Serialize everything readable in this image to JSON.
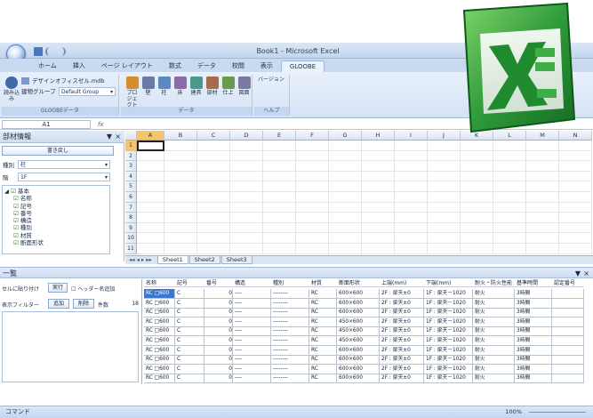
{
  "window_title": "Book1 - Microsoft Excel",
  "tabs": [
    "ホーム",
    "挿入",
    "ページ レイアウト",
    "数式",
    "データ",
    "校閲",
    "表示",
    "GLOOBE"
  ],
  "ribbon": {
    "file_label": "デザインオフィスゼル.mdb",
    "group_label": "建物グループ",
    "group_value": "Default Group",
    "load_label": "読み込み",
    "gloobe_data_label": "GLOOBEデータ",
    "buttons": [
      "プロジェクト",
      "壁",
      "柱",
      "床",
      "建具",
      "部材",
      "仕上",
      "図面"
    ],
    "data_label": "データ",
    "version_label": "バージョン",
    "help_label": "ヘルプ"
  },
  "formula_bar": {
    "cell_ref": "A1",
    "fx": "fx"
  },
  "left_panel": {
    "title": "部材情報",
    "back_button": "書き戻し",
    "type_label": "種別",
    "type_value": "柱",
    "floor_label": "階",
    "floor_value": "1F",
    "tree_root": "基本",
    "tree_items": [
      "名称",
      "記号",
      "番号",
      "構造",
      "種別",
      "材質",
      "断面形状"
    ]
  },
  "grid": {
    "columns": [
      "A",
      "B",
      "C",
      "D",
      "E",
      "F",
      "G",
      "H",
      "I",
      "J",
      "K",
      "L",
      "M",
      "N"
    ],
    "rows": [
      "1",
      "2",
      "3",
      "4",
      "5",
      "6",
      "7",
      "8",
      "9",
      "10",
      "11"
    ]
  },
  "sheet_tabs": [
    "Sheet1",
    "Sheet2",
    "Sheet3"
  ],
  "list_panel": {
    "title": "一覧",
    "paste_label": "セルに貼り付け",
    "exec_button": "実行",
    "header_add_label": "ヘッダー名追加",
    "filter_label": "表示フィルター",
    "add_button": "追加",
    "delete_button": "削除",
    "count_label": "件数",
    "count_value": "18"
  },
  "table": {
    "headers": [
      "名称",
      "記号",
      "番号",
      "構造",
      "種別",
      "材質",
      "断面形状",
      "上端(mm)",
      "下端(mm)",
      "耐火・防火性能",
      "基準時間",
      "認定番号"
    ],
    "rows": [
      [
        "RC □600",
        "C",
        "0",
        "----",
        "--------",
        "RC",
        "600×600",
        "2F : 梁天±0",
        "1F : 梁天－1020",
        "耐火",
        "3時間",
        ""
      ],
      [
        "RC □600",
        "C",
        "0",
        "----",
        "--------",
        "RC",
        "600×600",
        "2F : 梁天±0",
        "1F : 梁天－1020",
        "耐火",
        "3時間",
        ""
      ],
      [
        "RC □600",
        "C",
        "0",
        "----",
        "--------",
        "RC",
        "600×600",
        "2F : 梁天±0",
        "1F : 梁天－1020",
        "耐火",
        "3時間",
        ""
      ],
      [
        "RC □600",
        "C",
        "0",
        "----",
        "--------",
        "RC",
        "450×600",
        "2F : 梁天±0",
        "1F : 梁天－1020",
        "耐火",
        "3時間",
        ""
      ],
      [
        "RC □600",
        "C",
        "0",
        "----",
        "--------",
        "RC",
        "450×600",
        "2F : 梁天±0",
        "1F : 梁天－1020",
        "耐火",
        "3時間",
        ""
      ],
      [
        "RC □600",
        "C",
        "0",
        "----",
        "--------",
        "RC",
        "450×600",
        "2F : 梁天±0",
        "1F : 梁天－1020",
        "耐火",
        "3時間",
        ""
      ],
      [
        "RC □600",
        "C",
        "0",
        "----",
        "--------",
        "RC",
        "600×600",
        "2F : 梁天±0",
        "1F : 梁天－1020",
        "耐火",
        "3時間",
        ""
      ],
      [
        "RC □600",
        "C",
        "0",
        "----",
        "--------",
        "RC",
        "600×600",
        "2F : 梁天±0",
        "1F : 梁天－1020",
        "耐火",
        "3時間",
        ""
      ],
      [
        "RC □600",
        "C",
        "0",
        "----",
        "--------",
        "RC",
        "600×600",
        "2F : 梁天±0",
        "1F : 梁天－1020",
        "耐火",
        "3時間",
        ""
      ],
      [
        "RC □600",
        "C",
        "0",
        "----",
        "--------",
        "RC",
        "600×600",
        "2F : 梁天±0",
        "1F : 梁天－1020",
        "耐火",
        "3時間",
        ""
      ]
    ]
  },
  "status": {
    "mode": "コマンド",
    "zoom": "100%"
  }
}
